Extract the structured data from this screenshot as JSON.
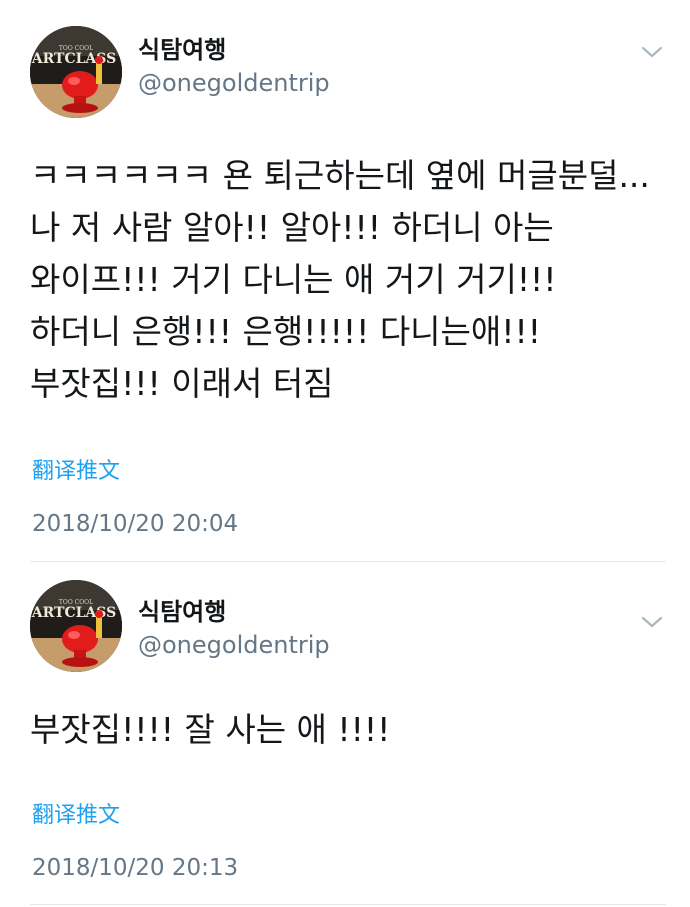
{
  "tweets": [
    {
      "display_name": "식탐여행",
      "handle": "@onegoldentrip",
      "text": "ㅋㅋㅋㅋㅋㅋ 욘 퇴근하는데 옆에 머글분덜... 나 저 사람 알아!! 알아!!! 하더니 아는 와이프!!! 거기 다니는 애 거기 거기!!! 하더니 은행!!! 은행!!!!! 다니는애!!! 부잣집!!! 이래서 터짐",
      "translate_label": "翻译推文",
      "timestamp": "2018/10/20 20:04"
    },
    {
      "display_name": "식탐여행",
      "handle": "@onegoldentrip",
      "text": "부잣집!!!! 잘 사는 애 !!!!",
      "translate_label": "翻译推文",
      "timestamp": "2018/10/20 20:13"
    }
  ],
  "avatar_logo_text": "ARTCLASS",
  "colors": {
    "link": "#1da1f2",
    "secondary_text": "#657786",
    "primary_text": "#14171a",
    "divider": "#e1e8ed"
  },
  "icons": {
    "menu": "chevron-down-icon"
  }
}
